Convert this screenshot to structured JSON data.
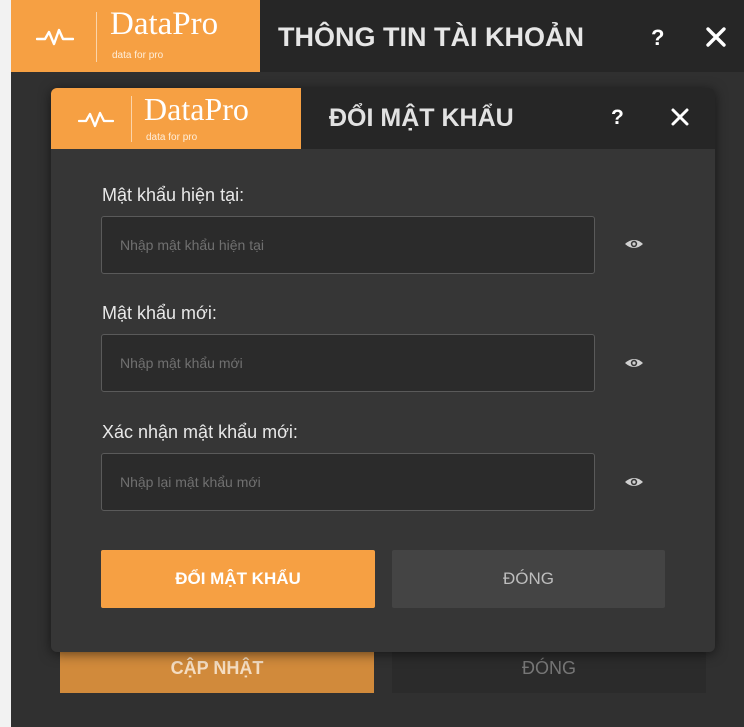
{
  "colors": {
    "accent": "#f6a043",
    "header_bg": "#262626",
    "panel_bg": "#363636",
    "input_bg": "#2b2b2b"
  },
  "brand": {
    "name": "DataPro",
    "tagline": "data for pro",
    "icon": "pulse-wave-icon"
  },
  "outer_window": {
    "title": "THÔNG TIN TÀI KHOẢN",
    "help_label": "?",
    "close_icon": "close-icon",
    "update_button": "CẬP NHẬT",
    "close_button": "ĐÓNG"
  },
  "dialog": {
    "title": "ĐỔI MẬT KHẨU",
    "help_label": "?",
    "close_icon": "close-icon",
    "fields": [
      {
        "label": "Mật khẩu hiện tại:",
        "placeholder": "Nhập mật khẩu hiện tại",
        "value": "",
        "icon": "eye-icon"
      },
      {
        "label": "Mật khẩu mới:",
        "placeholder": "Nhập mật khẩu mới",
        "value": "",
        "icon": "eye-icon"
      },
      {
        "label": "Xác nhận mật khẩu mới:",
        "placeholder": "Nhập lại mật khẩu mới",
        "value": "",
        "icon": "eye-icon"
      }
    ],
    "submit_button": "ĐỔI MẬT KHẨU",
    "close_button": "ĐÓNG"
  }
}
